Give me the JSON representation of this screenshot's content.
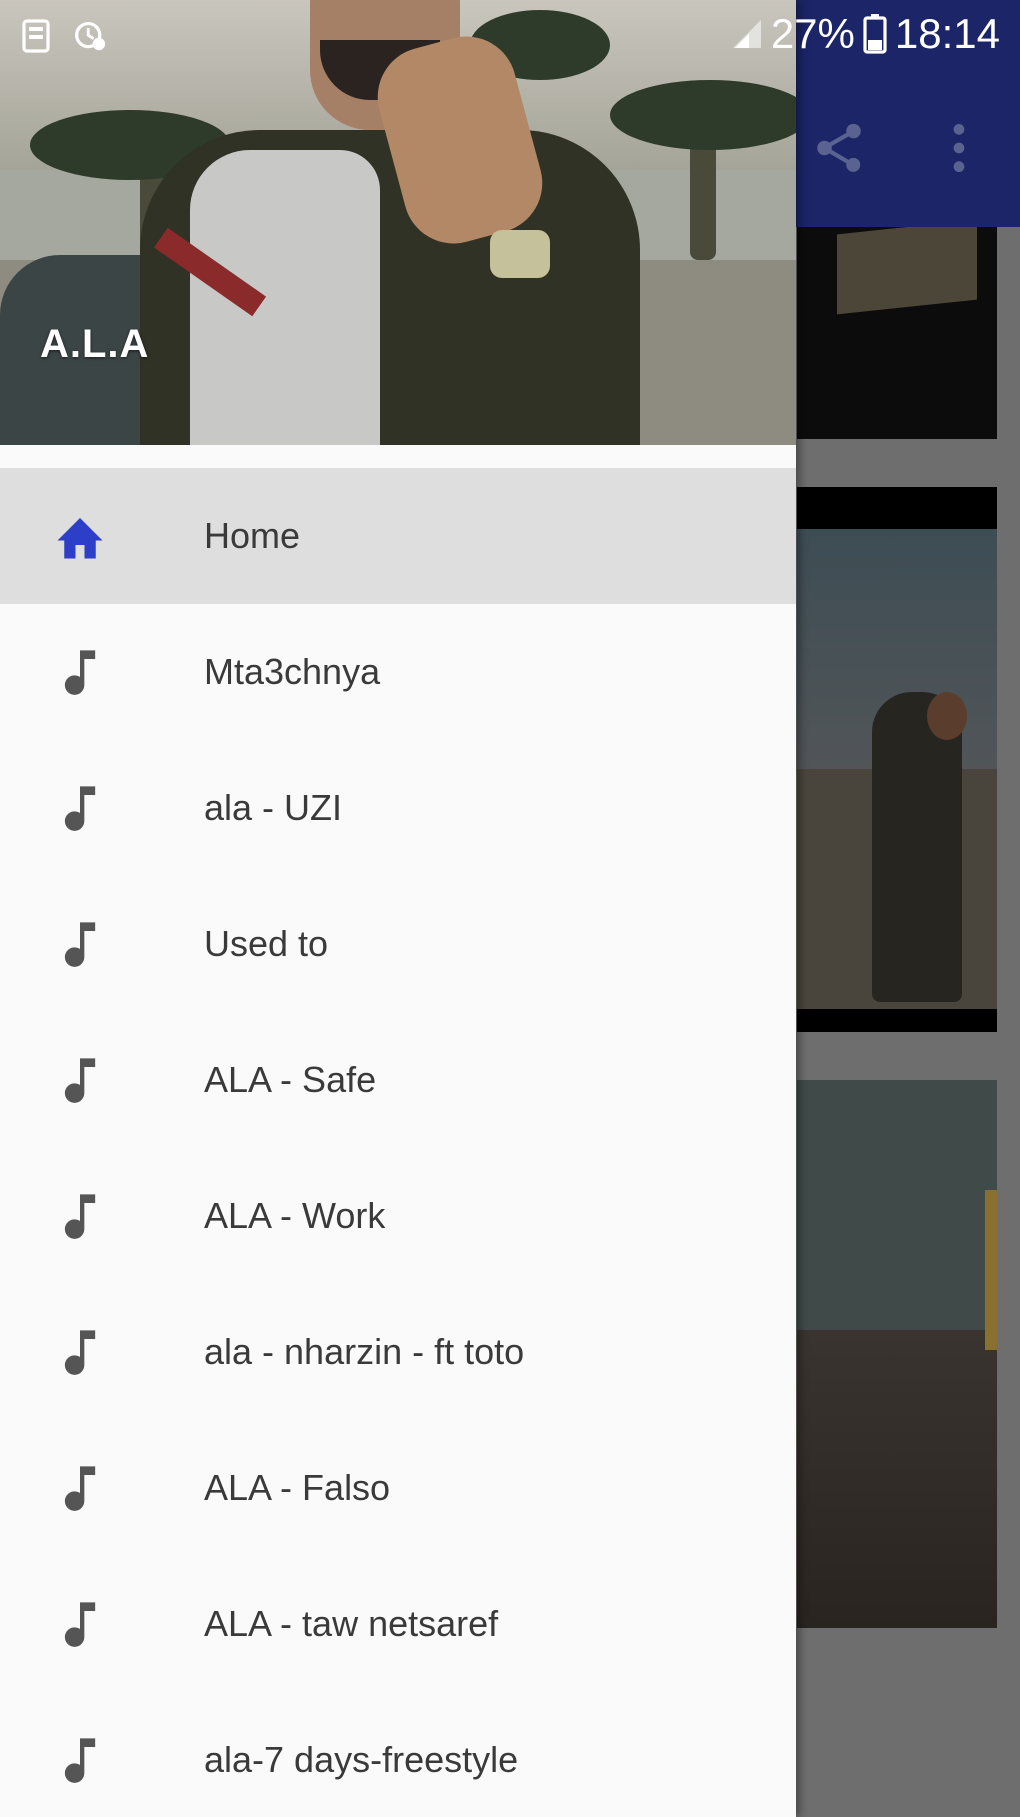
{
  "status_bar": {
    "battery": "27%",
    "time": "18:14"
  },
  "drawer": {
    "header": {
      "artist_name": "A.L.A"
    },
    "items": [
      {
        "label": "Home",
        "icon": "home-icon",
        "selected": true
      },
      {
        "label": "Mta3chnya",
        "icon": "music-note-icon"
      },
      {
        "label": "ala - UZI",
        "icon": "music-note-icon"
      },
      {
        "label": "Used to",
        "icon": "music-note-icon"
      },
      {
        "label": "ALA - Safe",
        "icon": "music-note-icon"
      },
      {
        "label": "ALA - Work",
        "icon": "music-note-icon"
      },
      {
        "label": "ala - nharzin - ft toto",
        "icon": "music-note-icon"
      },
      {
        "label": "ALA - Falso",
        "icon": "music-note-icon"
      },
      {
        "label": "ALA - taw netsaref",
        "icon": "music-note-icon"
      },
      {
        "label": "ala-7 days-freestyle",
        "icon": "music-note-icon"
      }
    ]
  },
  "toolbar": {
    "icons": [
      "share-icon",
      "overflow-menu-icon"
    ]
  },
  "colors": {
    "toolbar": "#1b2567",
    "accent": "#2d3fc8",
    "selected_row": "#dedede",
    "icon_gray": "#555555"
  }
}
